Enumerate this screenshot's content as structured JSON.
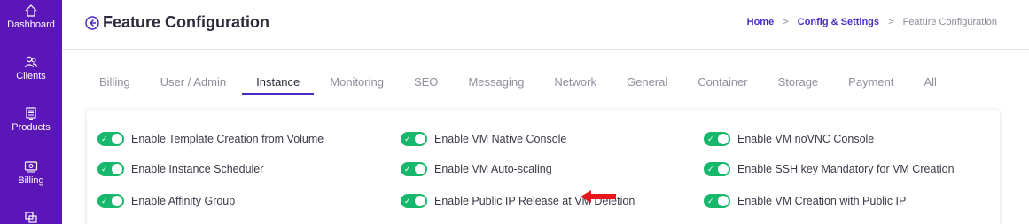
{
  "sidebar": {
    "items": [
      {
        "label": "Dashboard",
        "icon": "home-icon"
      },
      {
        "label": "Clients",
        "icon": "users-icon"
      },
      {
        "label": "Products",
        "icon": "server-icon"
      },
      {
        "label": "Billing",
        "icon": "billing-icon"
      },
      {
        "label": "",
        "icon": "layers-icon"
      }
    ]
  },
  "header": {
    "title": "Feature Configuration",
    "breadcrumb": {
      "home": "Home",
      "sep": ">",
      "config": "Config & Settings",
      "current": "Feature Configuration"
    }
  },
  "tabs": [
    "Billing",
    "User / Admin",
    "Instance",
    "Monitoring",
    "SEO",
    "Messaging",
    "Network",
    "General",
    "Container",
    "Storage",
    "Payment",
    "All"
  ],
  "active_tab": "Instance",
  "toggles": {
    "col1": [
      {
        "label": "Enable Template Creation from Volume",
        "on": true
      },
      {
        "label": "Enable Instance Scheduler",
        "on": true
      },
      {
        "label": "Enable Affinity Group",
        "on": true
      }
    ],
    "col2": [
      {
        "label": "Enable VM Native Console",
        "on": true
      },
      {
        "label": "Enable VM Auto-scaling",
        "on": true
      },
      {
        "label": "Enable Public IP Release at VM Deletion",
        "on": true
      }
    ],
    "col3": [
      {
        "label": "Enable VM noVNC Console",
        "on": true
      },
      {
        "label": "Enable SSH key Mandatory for VM Creation",
        "on": true
      },
      {
        "label": "Enable VM Creation with Public IP",
        "on": true
      }
    ]
  },
  "colors": {
    "sidebar": "#5b16b8",
    "accent": "#4b2bc0",
    "toggle_on": "#17b86b",
    "arrow": "#e8141c"
  }
}
